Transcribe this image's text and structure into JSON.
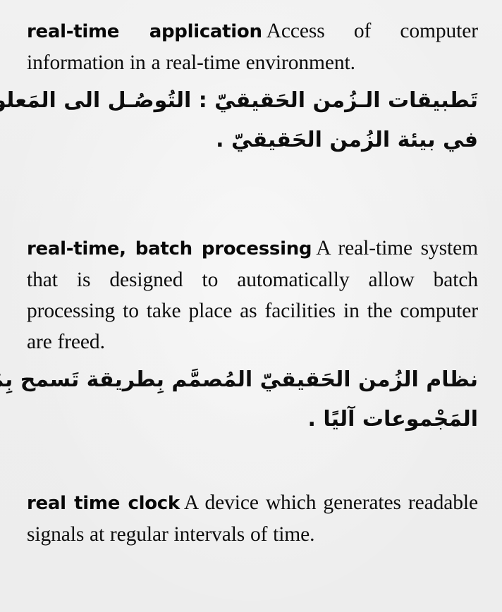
{
  "page": {
    "background_color": "#efefef",
    "text_color": "#0d0d0d",
    "kind": "bilingual-dictionary-page"
  },
  "entries": [
    {
      "headword": "real-time application",
      "definition_en": "Access of computer information in a real-time environment.",
      "definition_ar_line1": "تَطبيقات الـزُمن الحَقيقيّ : التُوصُـل الى المَعلومات",
      "definition_ar_line2": "في بيئة الزُمن الحَقيقيّ ."
    },
    {
      "headword": "real-time, batch processing",
      "definition_en": "A real-time system that is designed to automatically allow batch processing to take place as facilities in the computer are freed.",
      "definition_ar_line1": "نظام الزُمن الحَقيقيّ المُصمَّم بِطريقة تَسمح بِمُعالجـة",
      "definition_ar_line2": "المَجْموعات آليًا ."
    },
    {
      "headword": "real time clock",
      "definition_en": "A device which generates readable signals at regular intervals of time.",
      "definition_ar_line1": "",
      "definition_ar_line2": ""
    }
  ]
}
